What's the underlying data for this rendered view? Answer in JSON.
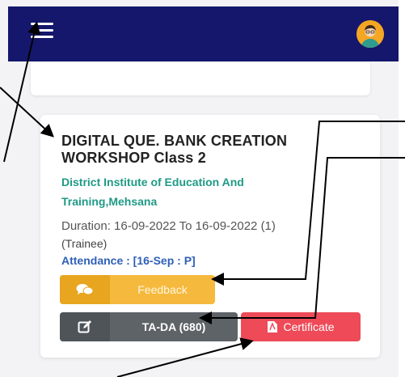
{
  "app": {
    "bar_color": "#14176b",
    "menu_icon": "hamburger-menu-icon",
    "avatar_icon": "user-avatar-icon"
  },
  "course": {
    "title": "DIGITAL QUE. BANK CREATION WORKSHOP Class 2",
    "institute": "District Institute of Education And Training,Mehsana",
    "duration": "Duration: 16-09-2022 To 16-09-2022 (1)",
    "role": "(Trainee)",
    "attendance": "Attendance : [16-Sep : P]"
  },
  "buttons": {
    "feedback_label": "Feedback",
    "feedback_icon": "chat-bubbles-icon",
    "tada_label": "TA-DA (680)",
    "tada_icon": "edit-icon",
    "certificate_label": "Certificate",
    "certificate_icon": "pdf-file-icon"
  },
  "colors": {
    "institute": "#1f9a86",
    "attendance": "#2e5fb8",
    "feedback": "#f5b93e",
    "tada": "#5e6368",
    "certificate": "#ee4a58"
  }
}
